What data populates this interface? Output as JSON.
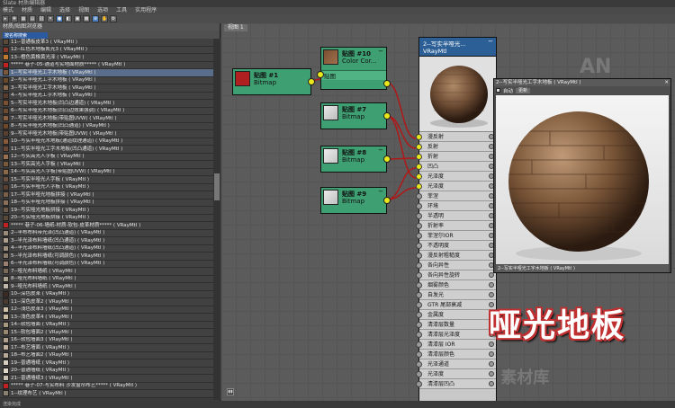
{
  "app": {
    "title": "Slate 材质编辑器",
    "menus": [
      "模式",
      "材质",
      "编辑",
      "选择",
      "视图",
      "选项",
      "工具",
      "实用程序"
    ]
  },
  "browser": {
    "title": "材质/贴图浏览器",
    "search_value": "按名称搜索",
    "items": [
      {
        "name": "11--普通板皮革3   ( VRayMtl )",
        "color": "#5a4a3a"
      },
      {
        "name": "12--红色木地板凯光3  ( VRayMtl )",
        "color": "#8a3a2a"
      },
      {
        "name": "13--橙色黄橡黄光泽  ( VRayMtl )",
        "color": "#c07a30"
      },
      {
        "name": "***** 巷子-05-通道写实地面材质*****  ( VRayMtl )",
        "color": "#c02020"
      },
      {
        "name": "1--写实半哑光工字木地板   ( VRayMtl )",
        "color": "#7a5a3a",
        "selected": true
      },
      {
        "name": "2--写实半哑光工字木地板   ( VRayMtl )",
        "color": "#6a4a2a"
      },
      {
        "name": "3--写实半哑光工字木地板   ( VRayMtl )",
        "color": "#8a6a4a"
      },
      {
        "name": "4--写实半哑光工字木地板   ( VRayMtl )",
        "color": "#5a3a2a"
      },
      {
        "name": "5--写实半哑光木地板(凹凸边通道)  ( VRayMtl )",
        "color": "#7a5030"
      },
      {
        "name": "6--写实半哑光木地板(凹凸边效果强调)  ( VRayMtl )",
        "color": "#6a4a30"
      },
      {
        "name": "7--写实半哑光木地板(带贴图UVW)  ( VRayMtl )",
        "color": "#8a6040"
      },
      {
        "name": "8--写实半哑光木地板(凹凸通道)  ( VRayMtl )",
        "color": "#704828"
      },
      {
        "name": "9--写实半哑光木地板(带贴图UVW)  ( VRayMtl )",
        "color": "#5a4030"
      },
      {
        "name": "10--写实半哑光木地板(通道纹理通道)  ( VRayMtl )",
        "color": "#8a5a3a"
      },
      {
        "name": "11--写实半哑光工字木地板(凹凸通道)  ( VRayMtl )",
        "color": "#6a4838"
      },
      {
        "name": "12--写实高光人字板   ( VRayMtl )",
        "color": "#9a7050"
      },
      {
        "name": "13--写实高光人字板   ( VRayMtl )",
        "color": "#7a5a3a"
      },
      {
        "name": "14--写实高光人字板(带贴图UVW)  ( VRayMtl )",
        "color": "#8a6848"
      },
      {
        "name": "15--写实半哑光人字板   ( VRayMtl )",
        "color": "#6a5040"
      },
      {
        "name": "16--写实半哑光人字板   ( VRayMtl )",
        "color": "#5a4030"
      },
      {
        "name": "17--写实半哑光地板拼接   ( VRayMtl )",
        "color": "#7a6048"
      },
      {
        "name": "18--写实半哑光地板拼接   ( VRayMtl )",
        "color": "#8a7058"
      },
      {
        "name": "19--写实哑光地板拼接   ( VRayMtl )",
        "color": "#6a5848"
      },
      {
        "name": "20--写实哑光地板拼接   ( VRayMtl )",
        "color": "#5a4838"
      },
      {
        "name": "***** 巷子-06-墙纸-材质-软包-皮革材质*****  ( VRayMtl )",
        "color": "#c02020"
      },
      {
        "name": "2--半布布料带光泽(凹凸通道)  ( VRayMtl )",
        "color": "#9a8a7a"
      },
      {
        "name": "3--半光泽布料墙纸(凹凸通道)  ( VRayMtl )",
        "color": "#b0a090"
      },
      {
        "name": "4--半光泽布料墙纸(凹凸通道)  ( VRayMtl )",
        "color": "#a09080"
      },
      {
        "name": "5--半光泽布料墙纸(可调颜色)  ( VRayMtl )",
        "color": "#8a7a6a"
      },
      {
        "name": "6--半光泽布料墙纸(可调颜色)  ( VRayMtl )",
        "color": "#9a8070"
      },
      {
        "name": "7--哑光布料墙纸   ( VRayMtl )",
        "color": "#7a6a5a"
      },
      {
        "name": "8--哑光布料墙纸   ( VRayMtl )",
        "color": "#aaa090"
      },
      {
        "name": "9--哑光布料墙纸   ( VRayMtl )",
        "color": "#c0b8a8"
      },
      {
        "name": "10--深色皮革   ( VRayMtl )",
        "color": "#3a2a22"
      },
      {
        "name": "11--深色皮革2   ( VRayMtl )",
        "color": "#4a3a30"
      },
      {
        "name": "12--浅色皮革3   ( VRayMtl )",
        "color": "#d0c0a8"
      },
      {
        "name": "13--浅色皮革4   ( VRayMtl )",
        "color": "#c8b8a0"
      },
      {
        "name": "14--软包墙面   ( VRayMtl )",
        "color": "#a89880"
      },
      {
        "name": "15--软包墙面2   ( VRayMtl )",
        "color": "#988870"
      },
      {
        "name": "16--软包墙面3   ( VRayMtl )",
        "color": "#b0a090"
      },
      {
        "name": "17--布艺墙面   ( VRayMtl )",
        "color": "#c0b0a0"
      },
      {
        "name": "18--布艺墙面2   ( VRayMtl )",
        "color": "#b8a898"
      },
      {
        "name": "19--普通墙纸   ( VRayMtl )",
        "color": "#d8d0c0"
      },
      {
        "name": "20--普通墙纸   ( VRayMtl )",
        "color": "#e0d8c8"
      },
      {
        "name": "21--普通墙纸3   ( VRayMtl )",
        "color": "#c8c0b0"
      },
      {
        "name": "***** 巷子-07-写实布料 沙发窗帘布艺*****  ( VRayMtl )",
        "color": "#c02020"
      },
      {
        "name": "1--纹理布艺   ( VRayMtl )",
        "color": "#8a8070"
      }
    ]
  },
  "view": {
    "tab_label": "视图 1",
    "watermark1": "AN",
    "watermark2": "AN 素材库"
  },
  "nodes": {
    "n1": {
      "title": "贴图 #1",
      "sub": "Bitmap",
      "color": "#b02020"
    },
    "n10": {
      "title": "贴图 #10",
      "sub": "Color Cor...",
      "slot": "贴图"
    },
    "n7": {
      "title": "贴图 #7",
      "sub": "Bitmap"
    },
    "n8": {
      "title": "贴图 #8",
      "sub": "Bitmap"
    },
    "n9": {
      "title": "贴图 #9",
      "sub": "Bitmap"
    }
  },
  "vray_node": {
    "title": "2--写实半哑光...",
    "type": "VRayMtl",
    "slots": [
      "漫反射",
      "反射",
      "折射",
      "凹凸",
      "光泽度",
      "光泽度",
      "菲涅",
      "环境",
      "半透明",
      "折射率",
      "菲涅尔IOR",
      "不透明度",
      "漫反射粗糙度",
      "各向异性",
      "各向异性旋转",
      "烟雾颜色",
      "自发光",
      "GTR 尾部衰减",
      "金属度",
      "清漆层数量",
      "清漆层光泽度",
      "清漆层 IOR",
      "清漆层颜色",
      "光泽通道",
      "光泽度",
      "清漆层凹凸"
    ],
    "connected_slots": [
      0,
      1,
      2,
      3,
      4,
      5
    ]
  },
  "preview": {
    "title": "2--写实半哑光工字木地板 ( VRayMtl )",
    "auto_label": "自动",
    "update_label": "更新",
    "footer": "2--写实半哑光工字木地板   ( VRayMtl )"
  },
  "overlay_text": "哑光地板",
  "status": "渲染完成"
}
